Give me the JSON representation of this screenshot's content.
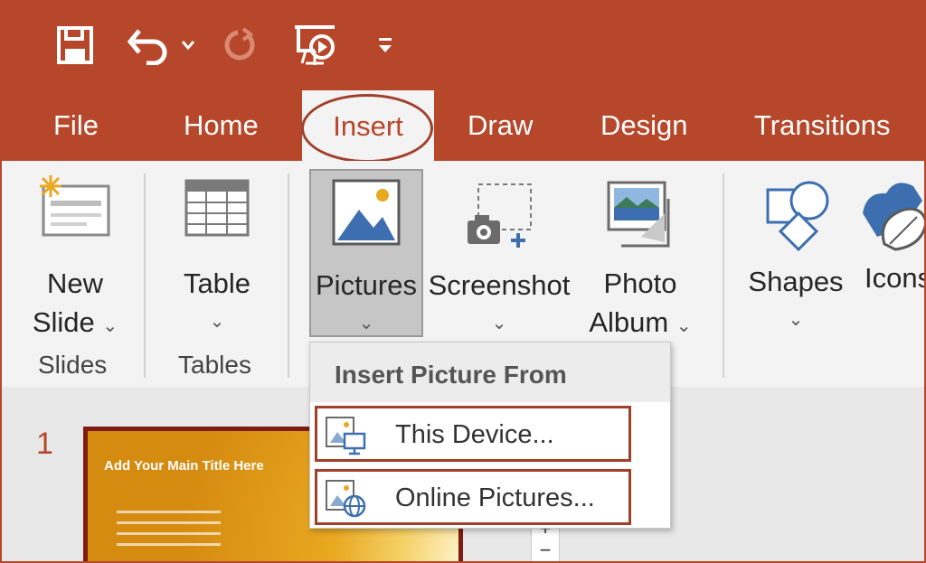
{
  "qat": {
    "save_icon": "save-icon",
    "undo_icon": "undo-icon",
    "redo_icon": "redo-icon",
    "present_icon": "present-from-start-icon",
    "customize_icon": "customize-qat-icon"
  },
  "tabs": [
    {
      "label": "File"
    },
    {
      "label": "Home"
    },
    {
      "label": "Insert"
    },
    {
      "label": "Draw"
    },
    {
      "label": "Design"
    },
    {
      "label": "Transitions"
    }
  ],
  "ribbon": {
    "new_slide": {
      "line1": "New",
      "line2": "Slide"
    },
    "table": {
      "label": "Table"
    },
    "pictures": {
      "label": "Pictures"
    },
    "screenshot": {
      "label": "Screenshot"
    },
    "photo_album": {
      "line1": "Photo",
      "line2": "Album"
    },
    "shapes": {
      "label": "Shapes"
    },
    "icons": {
      "label": "Icons"
    },
    "groups": {
      "slides": "Slides",
      "tables": "Tables"
    }
  },
  "dropdown": {
    "header": "Insert Picture From",
    "items": [
      {
        "label": "This Device...",
        "icon": "this-device-icon"
      },
      {
        "label": "Online Pictures...",
        "icon": "online-pictures-icon"
      }
    ]
  },
  "slides": {
    "number": "1",
    "thumb_title": "Add Your Main Title Here"
  },
  "zoom": {
    "plus": "+",
    "minus": "−"
  },
  "colors": {
    "accent": "#b7472a",
    "ribbon": "#f3f3f3",
    "highlight": "#a0402a"
  }
}
